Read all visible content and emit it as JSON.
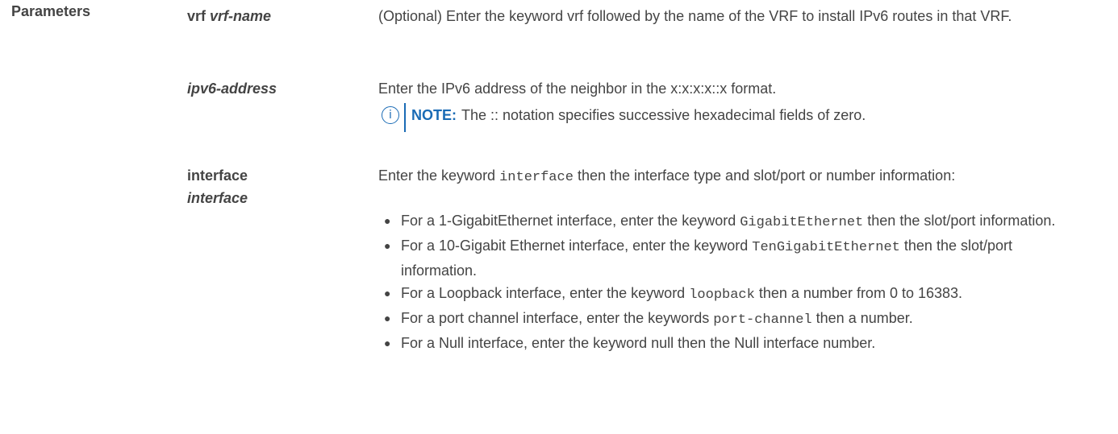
{
  "section": {
    "label": "Parameters"
  },
  "params": [
    {
      "term_keyword": "vrf",
      "term_italic": "vrf-name",
      "desc": "(Optional) Enter the keyword vrf followed by the name of the VRF to install IPv6 routes in that VRF."
    },
    {
      "term_italic": "ipv6-address",
      "desc": "Enter the IPv6 address of the neighbor in the x:x:x:x::x format.",
      "note_label": "NOTE:",
      "note_text": "The :: notation specifies successive hexadecimal fields of zero."
    },
    {
      "term_keyword": "interface",
      "term_italic": "interface",
      "desc_pre": "Enter the keyword",
      "desc_code": "interface",
      "desc_post": "then the interface type and slot/port or number information:",
      "bullets": [
        {
          "pre": "For a 1-GigabitEthernet interface, enter the keyword",
          "code": "GigabitEthernet",
          "post": "then the slot/port information."
        },
        {
          "pre": "For a 10-Gigabit Ethernet interface, enter the keyword",
          "code": "TenGigabitEthernet",
          "post": "then the slot/port information."
        },
        {
          "pre": "For a Loopback interface, enter the keyword",
          "code": "loopback",
          "post": "then a number from 0 to 16383."
        },
        {
          "pre": "For a port channel interface, enter the keywords",
          "code": "port-channel",
          "post": "then a number."
        },
        {
          "pre": "For a Null interface, enter the keyword null then the Null interface number.",
          "code": "",
          "post": ""
        }
      ]
    }
  ],
  "colors": {
    "text": "#444444",
    "note_accent": "#1a6bb5"
  },
  "icons": {
    "note": "info-circle-icon",
    "bullet": "bullet-dot-icon"
  }
}
